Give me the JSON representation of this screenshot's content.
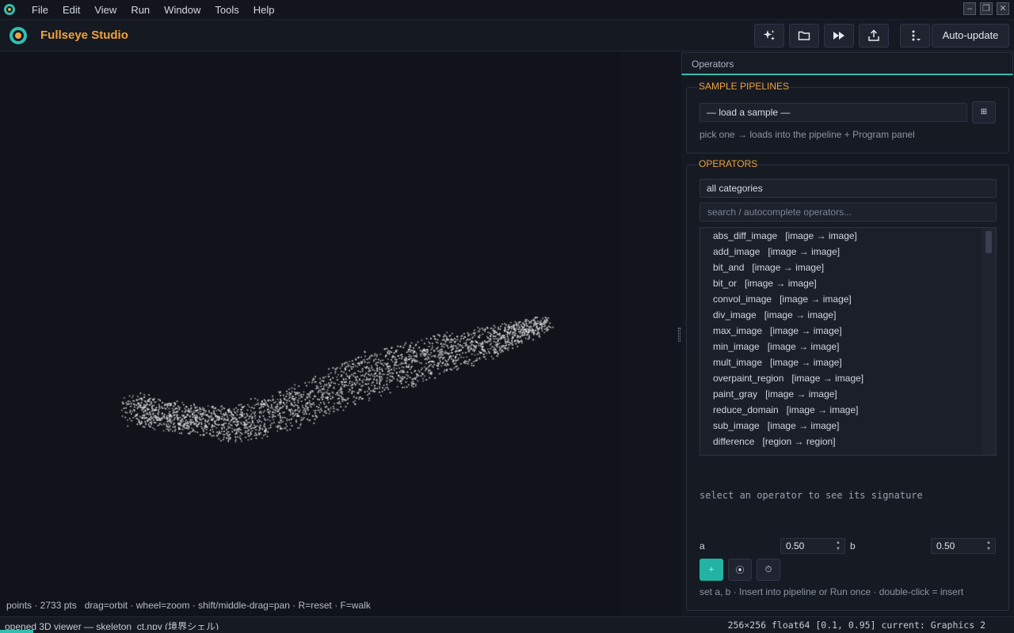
{
  "menu": [
    "File",
    "Edit",
    "View",
    "Run",
    "Window",
    "Tools",
    "Help"
  ],
  "window_controls": [
    "minimize",
    "restore",
    "close"
  ],
  "toolbar": {
    "title": "Fullseye Studio",
    "buttons": [
      "sparkle-icon",
      "folder-icon",
      "fast-forward-icon",
      "export-icon",
      "more-vertical-icon"
    ],
    "autoupdate_label": "Auto-update"
  },
  "viewer": {
    "hint": "points · 2733 pts   drag=orbit · wheel=zoom · shift/middle-drag=pan · R=reset · F=walk"
  },
  "panel": {
    "tab": "Operators",
    "samples": {
      "title": "SAMPLE PIPELINES",
      "select_value": "— load a sample —",
      "button_glyph": "⊞",
      "hint": "pick one → loads into the pipeline + Program panel"
    },
    "operators": {
      "title": "OPERATORS",
      "category": "all categories",
      "search_placeholder": "search / autocomplete operators...",
      "items": [
        {
          "name": "abs_diff_image",
          "sig": "[image → image]"
        },
        {
          "name": "add_image",
          "sig": "[image → image]"
        },
        {
          "name": "bit_and",
          "sig": "[image → image]"
        },
        {
          "name": "bit_or",
          "sig": "[image → image]"
        },
        {
          "name": "convol_image",
          "sig": "[image → image]"
        },
        {
          "name": "div_image",
          "sig": "[image → image]"
        },
        {
          "name": "max_image",
          "sig": "[image → image]"
        },
        {
          "name": "min_image",
          "sig": "[image → image]"
        },
        {
          "name": "mult_image",
          "sig": "[image → image]"
        },
        {
          "name": "overpaint_region",
          "sig": "[image → image]"
        },
        {
          "name": "paint_gray",
          "sig": "[image → image]"
        },
        {
          "name": "reduce_domain",
          "sig": "[image → image]"
        },
        {
          "name": "sub_image",
          "sig": "[image → image]"
        },
        {
          "name": "difference",
          "sig": "[region → region]"
        }
      ],
      "signature_text": "select an operator to see its signature",
      "param_a_label": "a",
      "param_a_value": "0.50",
      "param_b_label": "b",
      "param_b_value": "0.50",
      "btn_insert": "+",
      "btn_run": "⦿",
      "btn_timer": "⏱",
      "footer_hint": "set a, b · Insert into pipeline or Run once · double-click = insert"
    }
  },
  "status": {
    "left": "opened 3D viewer — skeleton_ct.npy (境界シェル)",
    "right": "256×256 float64 [0.1, 0.95] current: Graphics 2",
    "progress": 0.033
  },
  "colors": {
    "accent": "#2fbfb1",
    "brand": "#f0a23a",
    "background": "#12151d"
  }
}
